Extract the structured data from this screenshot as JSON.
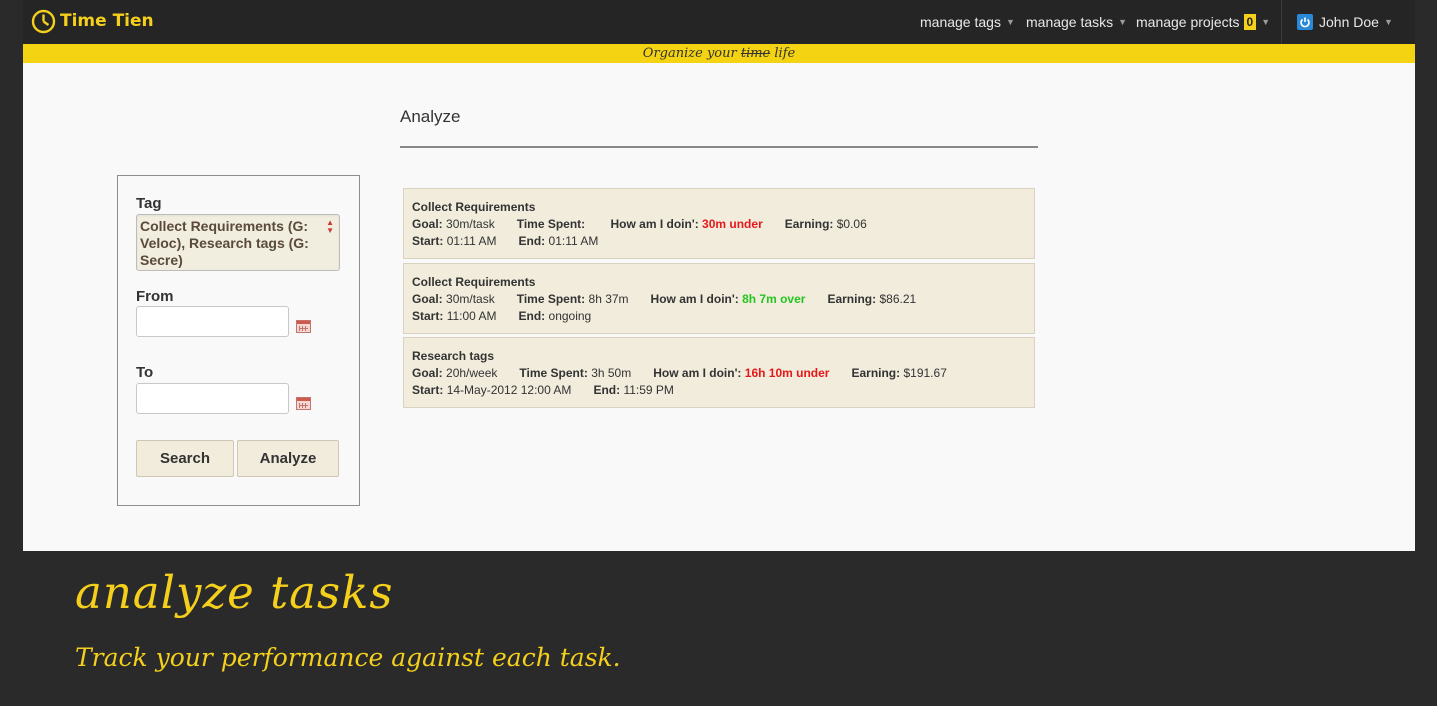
{
  "app": {
    "name": "Time Tien",
    "tagline_prefix": "Organize your ",
    "tagline_struck": "time",
    "tagline_suffix": " life"
  },
  "nav": {
    "manage_tags": "manage tags",
    "manage_tasks": "manage tasks",
    "manage_projects": "manage projects",
    "projects_count": "0",
    "user_name": "John Doe"
  },
  "page": {
    "title": "Analyze"
  },
  "form": {
    "tag_label": "Tag",
    "tag_value": "Collect Requirements (G: Veloc), Research tags (G: Secre)",
    "from_label": "From",
    "from_value": "",
    "to_label": "To",
    "to_value": "",
    "search_label": "Search",
    "analyze_label": "Analyze"
  },
  "labels": {
    "goal": "Goal:",
    "time_spent": "Time Spent:",
    "how": "How am I doin':",
    "earning": "Earning:",
    "start": "Start:",
    "end": "End:"
  },
  "results": [
    {
      "title": "Collect Requirements",
      "goal": "30m/task",
      "time_spent": "",
      "status": "30m under",
      "status_type": "under",
      "earning": "$0.06",
      "start": "01:11 AM",
      "end": "01:11 AM"
    },
    {
      "title": "Collect Requirements",
      "goal": "30m/task",
      "time_spent": "8h 37m",
      "status": "8h 7m over",
      "status_type": "over",
      "earning": "$86.21",
      "start": "11:00 AM",
      "end": "ongoing"
    },
    {
      "title": "Research tags",
      "goal": "20h/week",
      "time_spent": "3h 50m",
      "status": "16h 10m under",
      "status_type": "under",
      "earning": "$191.67",
      "start": "14-May-2012 12:00 AM",
      "end": "11:59 PM"
    }
  ],
  "colors": {
    "accent": "#f4cf1c",
    "under": "#e8171b",
    "over": "#25c51f"
  },
  "promo": {
    "heading": "analyze tasks",
    "subheading": "Track your performance against each task."
  }
}
